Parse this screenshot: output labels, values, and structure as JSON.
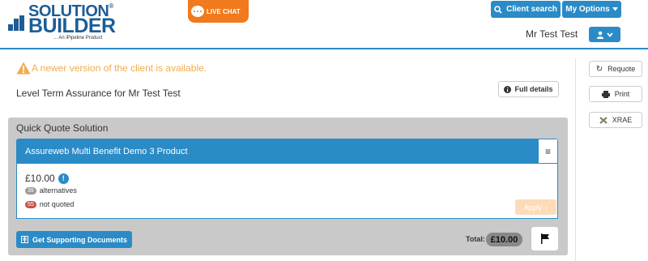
{
  "header": {
    "logo": {
      "line1": "SOLUTION",
      "reg": "®",
      "line2": "BUILDER",
      "tagline": "... An iPipeline Product"
    },
    "live_chat_label": "LIVE CHAT",
    "client_search_label": "Client search",
    "my_options_label": "My Options",
    "user_name": "Mr Test Test",
    "accent_color": "#2a8bc7"
  },
  "alert": {
    "message": "A newer version of the client is available.",
    "color": "#f0ad4e"
  },
  "policy": {
    "title": "Level Term Assurance for Mr Test Test",
    "full_details_label": "Full details"
  },
  "sidebar": {
    "requote_label": "Requote",
    "print_label": "Print",
    "xrae_label": "XRAE"
  },
  "quote": {
    "section_title": "Quick Quote Solution",
    "product_name": "Assureweb Multi Benefit Demo 3 Product",
    "price": "£10.00",
    "alternatives_count": "39",
    "alternatives_label": "alternatives",
    "not_quoted_count": "55",
    "not_quoted_label": "not quoted",
    "apply_label": "Apply",
    "get_docs_label": "Get Supporting Documents",
    "total_label": "Total:",
    "total_value": "£10.00"
  }
}
